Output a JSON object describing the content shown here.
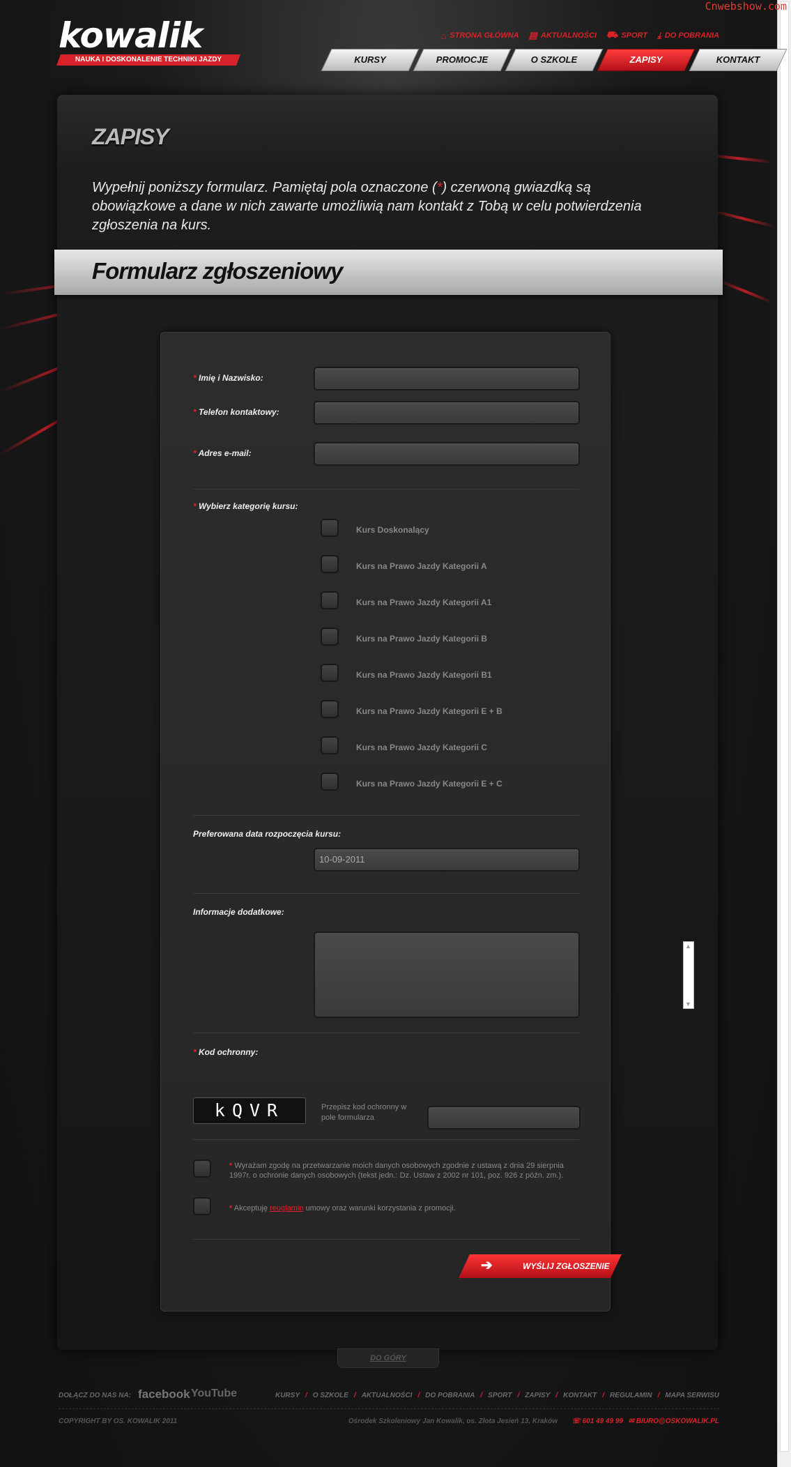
{
  "watermark": "Cnwebshow.com",
  "brand": {
    "logo_text": "kowalik",
    "tagline": "NAUKA I DOSKONALENIE TECHNIKI JAZDY"
  },
  "toplinks": [
    {
      "label": "STRONA GŁÓWNA",
      "icon": "home-icon"
    },
    {
      "label": "AKTUALNOŚCI",
      "icon": "news-icon"
    },
    {
      "label": "SPORT",
      "icon": "car-icon"
    },
    {
      "label": "DO POBRANIA",
      "icon": "download-icon"
    }
  ],
  "nav": [
    {
      "label": "KURSY",
      "active": false
    },
    {
      "label": "PROMOCJE",
      "active": false
    },
    {
      "label": "O SZKOLE",
      "active": false
    },
    {
      "label": "ZAPISY",
      "active": true
    },
    {
      "label": "KONTAKT",
      "active": false
    }
  ],
  "page": {
    "title": "ZAPISY",
    "intro_before": "Wypełnij poniższy formularz. Pamiętaj pola oznaczone (",
    "intro_star": "*",
    "intro_after": ") czerwoną gwiazdką są obowiązkowe a dane w nich zawarte umożliwią nam kontakt z Tobą w celu potwierdzenia zgłoszenia na kurs.",
    "form_heading": "Formularz zgłoszeniowy"
  },
  "form": {
    "required_mark": "*",
    "name_label": "Imię i Nazwisko:",
    "phone_label": "Telefon kontaktowy:",
    "email_label": "Adres e-mail:",
    "category_label": "Wybierz kategorię kursu:",
    "categories": [
      "Kurs Doskonalący",
      "Kurs na Prawo Jazdy Kategorii A",
      "Kurs na Prawo Jazdy Kategorii A1",
      "Kurs na Prawo Jazdy Kategorii B",
      "Kurs na Prawo Jazdy Kategorii B1",
      "Kurs na Prawo Jazdy Kategorii E + B",
      "Kurs na Prawo Jazdy Kategorii C",
      "Kurs na Prawo Jazdy Kategorii E + C"
    ],
    "date_label": "Preferowana data rozpoczęcia kursu:",
    "date_value": "10-09-2011",
    "info_label": "Informacje dodatkowe:",
    "captcha_label": "Kod ochronny:",
    "captcha_code": "kQVR",
    "captcha_hint": "Przepisz kod ochronny w pole formularza",
    "consent1": "Wyrażam zgodę na przetwarzanie moich danych osobowych zgodnie z ustawą z dnia 29 sierpnia 1997r. o ochronie danych osobowych (tekst jedn.: Dz. Ustaw z 2002 nr 101, poz. 926 z późn. zm.).",
    "consent2_before": "Akceptuję ",
    "consent2_link": "reuglamin",
    "consent2_after": " umowy oraz warunki korzystania z promocji.",
    "submit_label": "WYŚLIJ ZGŁOSZENIE"
  },
  "to_top": "DO GÓRY",
  "footer": {
    "join_label": "DOŁĄCZ DO NAS NA:",
    "facebook": "facebook",
    "youtube": "YouTube",
    "links": [
      "KURSY",
      "O SZKOLE",
      "AKTUALNOŚCI",
      "DO POBRANIA",
      "SPORT",
      "ZAPISY",
      "KONTAKT",
      "REGULAMIN",
      "MAPA SERWISU"
    ],
    "copyright": "COPYRIGHT BY OS. KOWALIK 2011",
    "address": "Ośrodek Szkoleniowy Jan Kowalik, os. Złota Jesień 13, Kraków",
    "phone": "601 49 49 99",
    "email": "BIURO@OSKOWALIK.PL"
  },
  "colors": {
    "accent": "#d8222a",
    "background": "#151515"
  }
}
